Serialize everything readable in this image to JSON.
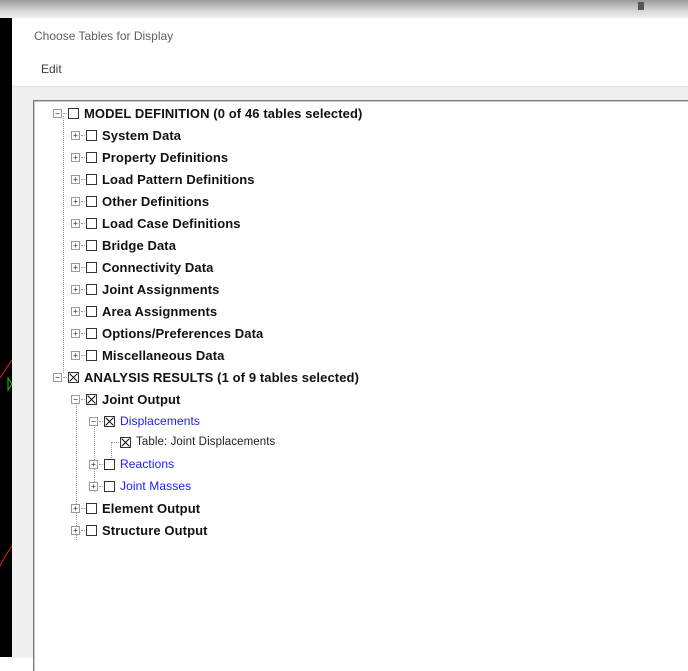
{
  "window": {
    "title": "Choose Tables for Display"
  },
  "menu": {
    "edit": "Edit"
  },
  "tree": {
    "model_definition": {
      "label": "MODEL DEFINITION  (0 of 46 tables selected)",
      "checked": false,
      "children": [
        "System Data",
        "Property Definitions",
        "Load Pattern Definitions",
        "Other Definitions",
        "Load Case Definitions",
        "Bridge Data",
        "Connectivity Data",
        "Joint Assignments",
        "Area Assignments",
        "Options/Preferences Data",
        "Miscellaneous Data"
      ]
    },
    "analysis_results": {
      "label": "ANALYSIS RESULTS  (1 of 9 tables selected)",
      "checked": true,
      "joint_output": {
        "label": "Joint Output",
        "displacements": "Displacements",
        "table_joint_displacements": "Table:  Joint Displacements",
        "reactions": "Reactions",
        "joint_masses": "Joint Masses"
      },
      "element_output": "Element Output",
      "structure_output": "Structure Output"
    }
  }
}
